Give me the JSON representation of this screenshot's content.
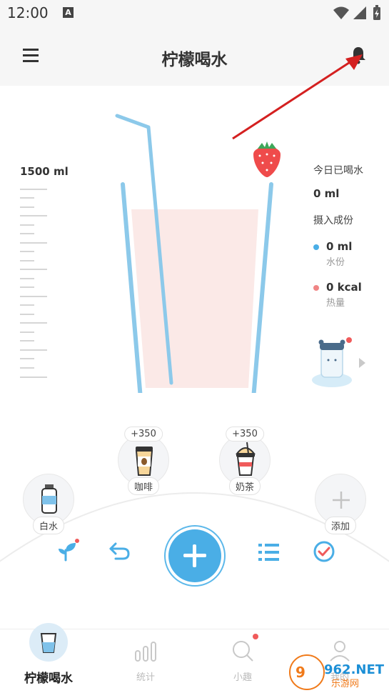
{
  "status_bar": {
    "time": "12:00",
    "notification_icon": "A"
  },
  "app_bar": {
    "title": "柠檬喝水",
    "left_icon": "menu-icon",
    "right_icon": "bell-icon"
  },
  "capacity": {
    "label": "1500 ml",
    "consumed_ml": 0
  },
  "today": {
    "title": "今日已喝水",
    "amount": "0 ml",
    "intake_title": "摄入成份",
    "water": {
      "value": "0 ml",
      "label": "水份",
      "color": "#4aaee6"
    },
    "calories": {
      "value": "0 kcal",
      "label": "热量",
      "color": "#f08585"
    }
  },
  "drinks": {
    "water": {
      "label": "白水",
      "icon": "water-bottle-icon"
    },
    "coffee": {
      "label": "咖啡",
      "amount": "+350",
      "icon": "coffee-cup-icon"
    },
    "milk_tea": {
      "label": "奶茶",
      "amount": "+350",
      "icon": "milk-tea-icon"
    },
    "add": {
      "label": "添加",
      "icon": "plus-icon"
    }
  },
  "actions": [
    "sprout-icon",
    "undo-icon",
    "add-drink-icon",
    "list-icon",
    "check-icon"
  ],
  "tabs": [
    {
      "label": "柠檬喝水",
      "icon": "cup-icon",
      "active": true
    },
    {
      "label": "统计",
      "icon": "bar-chart-icon",
      "active": false
    },
    {
      "label": "小趣",
      "icon": "discover-icon",
      "active": false
    },
    {
      "label": "我的",
      "icon": "profile-icon",
      "active": false
    }
  ],
  "watermark": {
    "brand": "962.NET",
    "sub": "乐游网"
  },
  "colors": {
    "accent": "#4aaee6",
    "glass_fill": "#fbe9e7",
    "badge": "#f05b5b"
  }
}
